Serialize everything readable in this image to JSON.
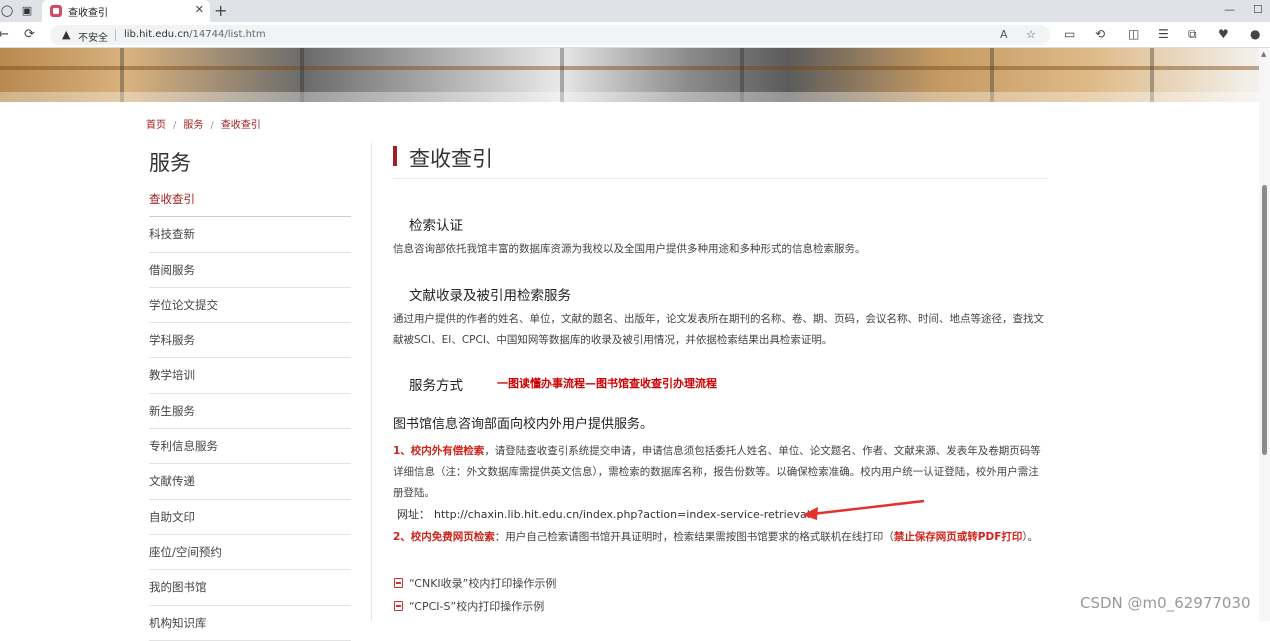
{
  "browser": {
    "tab_title": "查收查引",
    "tab_close": "✕",
    "new_tab": "+",
    "security": "不安全",
    "url_host": "lib.hit.edu.cn",
    "url_path": "/14744/list.htm",
    "window_min": "—",
    "window_max": "☐"
  },
  "breadcrumb": {
    "home": "首页",
    "service": "服务",
    "current": "查收查引",
    "sep": "/"
  },
  "sidebar": {
    "title": "服务",
    "items": [
      {
        "label": "查收查引"
      },
      {
        "label": "科技查新"
      },
      {
        "label": "借阅服务"
      },
      {
        "label": "学位论文提交"
      },
      {
        "label": "学科服务"
      },
      {
        "label": "教学培训"
      },
      {
        "label": "新生服务"
      },
      {
        "label": "专利信息服务"
      },
      {
        "label": "文献传递"
      },
      {
        "label": "自助文印"
      },
      {
        "label": "座位/空间预约"
      },
      {
        "label": "我的图书馆"
      },
      {
        "label": "机构知识库"
      }
    ]
  },
  "main": {
    "title": "查收查引",
    "s1_title": "检索认证",
    "s1_text": "信息咨询部依托我馆丰富的数据库资源为我校以及全国用户提供多种用途和多种形式的信息检索服务。",
    "s2_title": "文献收录及被引用检索服务",
    "s2_text": "通过用户提供的作者的姓名、单位，文献的题名、出版年，论文发表所在期刊的名称、卷、期、页码，会议名称、时间、地点等途径，查找文献被SCI、EI、CPCI、中国知网等数据库的收录及被引用情况，并依据检索结果出具检索证明。",
    "s3_title": "服务方式",
    "s3_link": "一图读懂办事流程—图书馆查收查引办理流程",
    "lead": "图书馆信息咨询部面向校内外用户提供服务。",
    "item1_red": "1、校内外有偿检索",
    "item1_text": "，请登陆查收查引系统提交申请，申请信息须包括委托人姓名、单位、论文题名、作者、文献来源、发表年及卷期页码等详细信息（注：外文数据库需提供英文信息），需检索的数据库名称，报告份数等。以确保检索准确。校内用户统一认证登陆，校外用户需注册登陆。",
    "web_label": "网址：",
    "web_url": "http://chaxin.lib.hit.edu.cn/index.php?action=index-service-retrieval",
    "item2_red": "2、校内免费网页检索",
    "item2_text": "：用户自己检索请图书馆开具证明时，检索结果需按图书馆要求的格式联机在线打印（",
    "item2_red2": "禁止保存网页或转PDF打印",
    "item2_end": "）。",
    "doc1": "“CNKI收录”校内打印操作示例",
    "doc2": "“CPCI-S”校内打印操作示例"
  },
  "watermark": "CSDN @m0_62977030"
}
